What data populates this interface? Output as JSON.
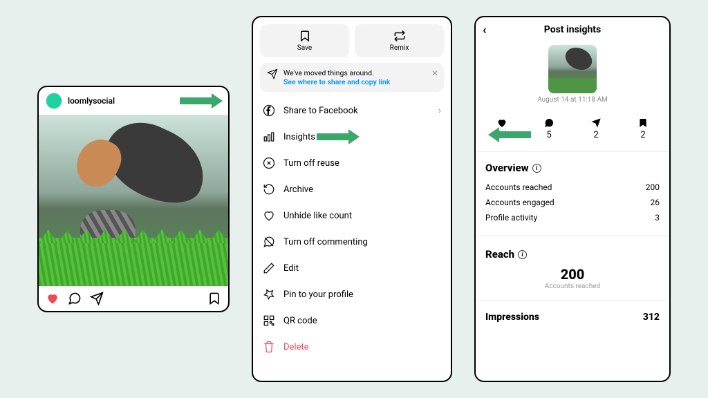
{
  "post": {
    "username": "loomlysocial"
  },
  "menu": {
    "save": "Save",
    "remix": "Remix",
    "notice_text": "We've moved things around.",
    "notice_link": "See where to share and copy link",
    "items": {
      "share_fb": "Share to Facebook",
      "insights": "Insights",
      "turn_off_reuse": "Turn off reuse",
      "archive": "Archive",
      "unhide_like": "Unhide like count",
      "turn_off_commenting": "Turn off commenting",
      "edit": "Edit",
      "pin": "Pin to your profile",
      "qr": "QR code",
      "delete": "Delete"
    }
  },
  "insights": {
    "title": "Post insights",
    "timestamp": "August 14 at 11:18 AM",
    "stats": {
      "likes": "24",
      "comments": "5",
      "shares": "2",
      "saves": "2"
    },
    "overview_title": "Overview",
    "overview": {
      "reached_label": "Accounts reached",
      "reached": "200",
      "engaged_label": "Accounts engaged",
      "engaged": "26",
      "activity_label": "Profile activity",
      "activity": "3"
    },
    "reach_title": "Reach",
    "reach_big": "200",
    "reach_sub": "Accounts reached",
    "impressions_label": "Impressions",
    "impressions": "312"
  }
}
